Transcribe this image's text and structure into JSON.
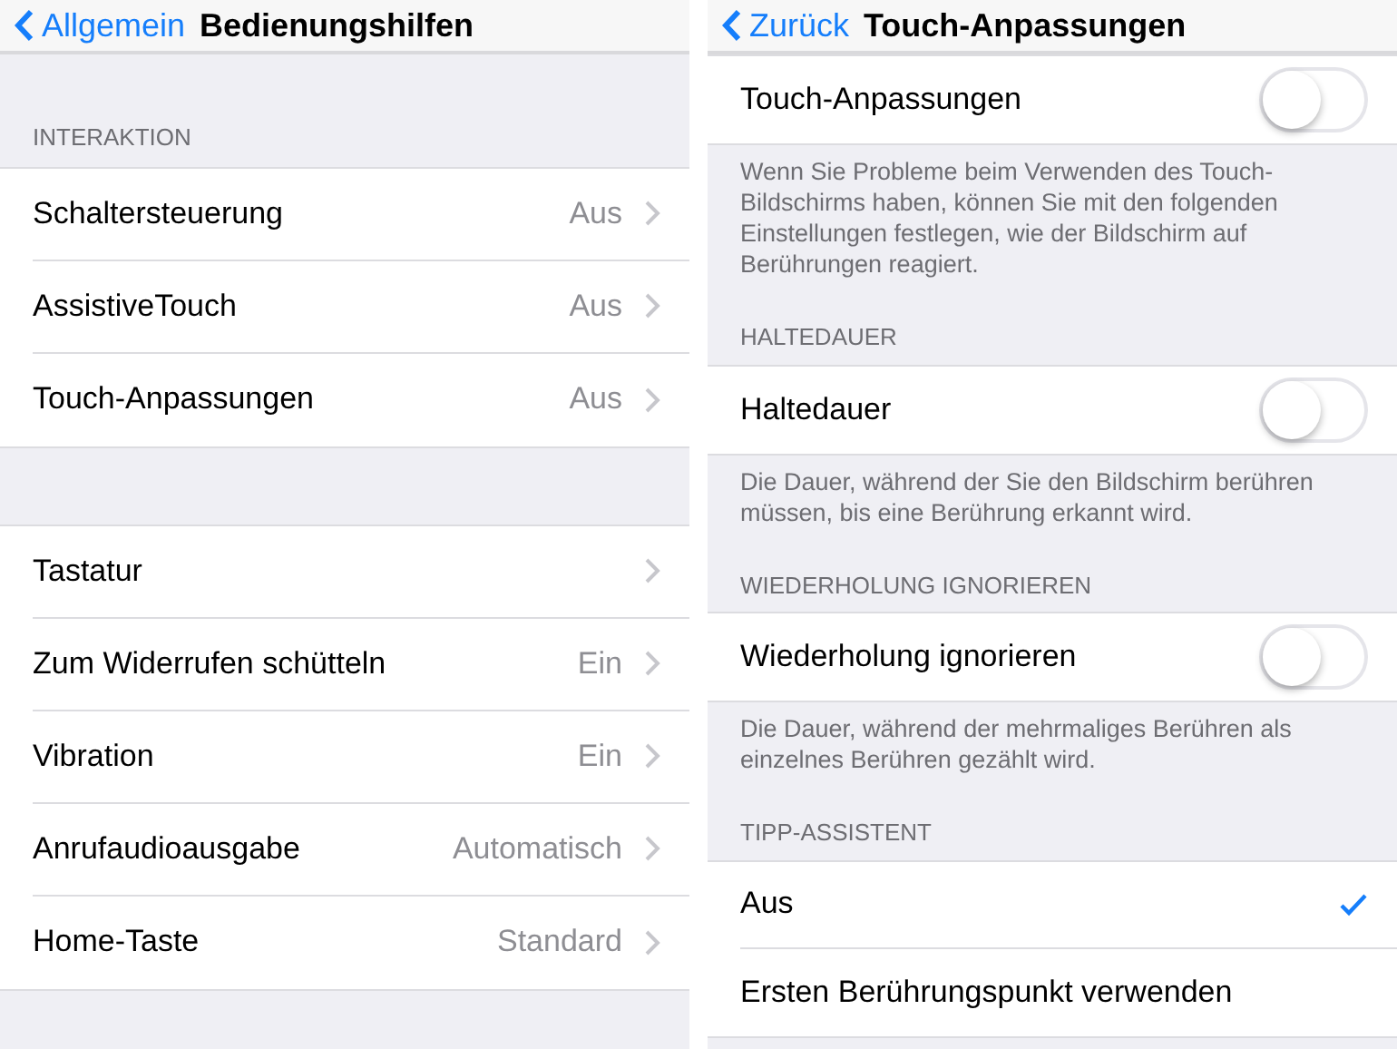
{
  "left": {
    "nav": {
      "back": "Allgemein",
      "title": "Bedienungshilfen"
    },
    "sections": [
      {
        "header": "INTERAKTION",
        "rows": [
          {
            "kind": "link",
            "label": "Schaltersteuerung",
            "value": "Aus"
          },
          {
            "kind": "link",
            "label": "AssistiveTouch",
            "value": "Aus"
          },
          {
            "kind": "link",
            "label": "Touch-Anpassungen",
            "value": "Aus"
          }
        ]
      },
      {
        "rows": [
          {
            "kind": "link",
            "label": "Tastatur"
          },
          {
            "kind": "link",
            "label": "Zum Widerrufen schütteln",
            "value": "Ein"
          },
          {
            "kind": "link",
            "label": "Vibration",
            "value": "Ein"
          },
          {
            "kind": "link",
            "label": "Anrufaudioausgabe",
            "value": "Automatisch"
          },
          {
            "kind": "link",
            "label": "Home-Taste",
            "value": "Standard"
          }
        ]
      }
    ]
  },
  "right": {
    "nav": {
      "back": "Zurück",
      "title": "Touch-Anpassungen"
    },
    "sections": [
      {
        "rows": [
          {
            "kind": "toggle",
            "label": "Touch-Anpassungen",
            "on": false
          }
        ],
        "footer": "Wenn Sie Probleme beim Verwenden des Touch-Bildschirms haben, können Sie mit den folgenden Einstellungen festlegen, wie der Bildschirm auf Berührungen reagiert."
      },
      {
        "header": "HALTEDAUER",
        "rows": [
          {
            "kind": "toggle",
            "label": "Haltedauer",
            "on": false
          }
        ],
        "footer": "Die Dauer, während der Sie den Bildschirm berühren müssen, bis eine Berührung erkannt wird."
      },
      {
        "header": "WIEDERHOLUNG IGNORIEREN",
        "rows": [
          {
            "kind": "toggle",
            "label": "Wiederholung ignorieren",
            "on": false
          }
        ],
        "footer": "Die Dauer, während der mehrmaliges Berühren als einzelnes Berühren gezählt wird."
      },
      {
        "header": "TIPP-ASSISTENT",
        "rows": [
          {
            "kind": "option",
            "label": "Aus",
            "selected": true
          },
          {
            "kind": "option",
            "label": "Ersten Berührungspunkt verwenden",
            "selected": false
          }
        ]
      }
    ]
  }
}
